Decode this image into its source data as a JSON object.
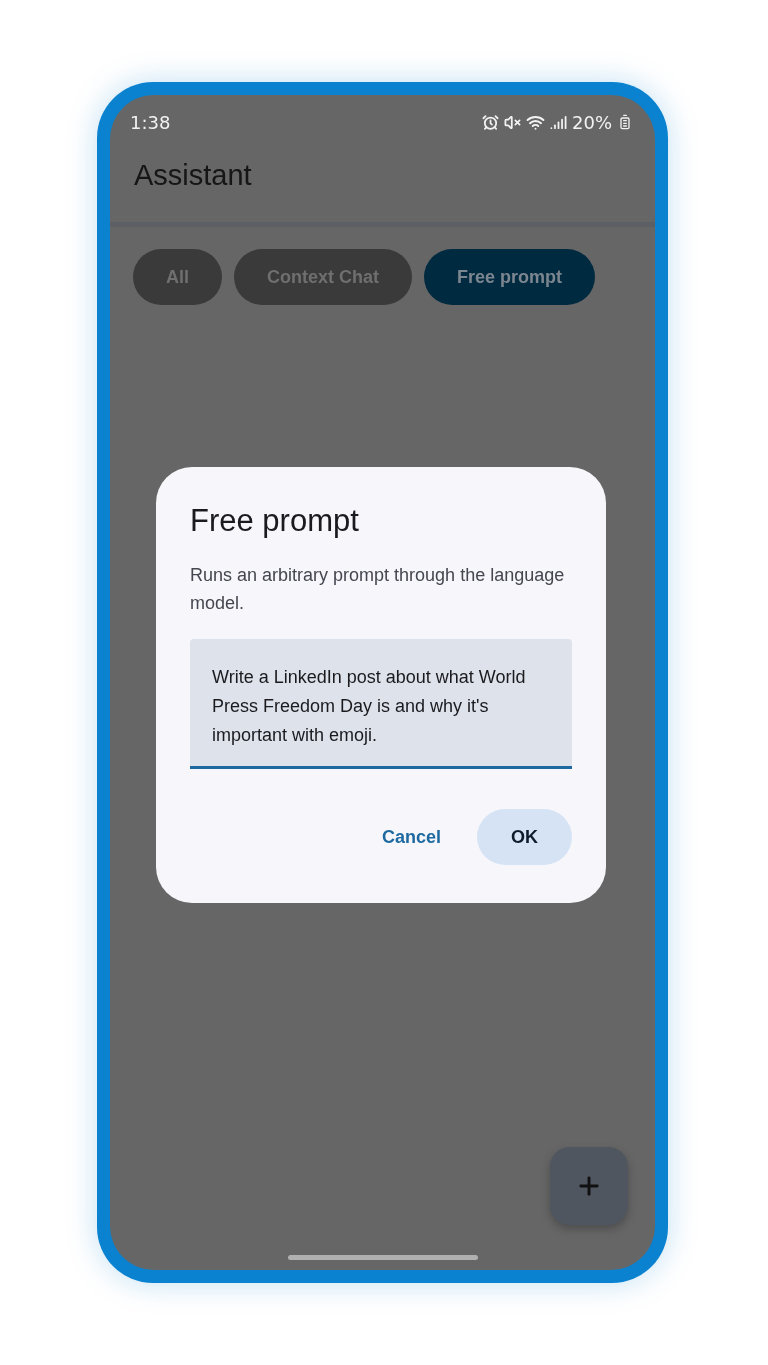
{
  "status_bar": {
    "time": "1:38",
    "battery": "20%"
  },
  "app_bar": {
    "title": "Assistant"
  },
  "chips": [
    {
      "label": "All",
      "selected": false
    },
    {
      "label": "Context Chat",
      "selected": false
    },
    {
      "label": "Free prompt",
      "selected": true
    }
  ],
  "dialog": {
    "title": "Free prompt",
    "description": "Runs an arbitrary prompt through the language model.",
    "field": {
      "value": "Write a LinkedIn post about what World Press Freedom Day is and why it's important with emoji."
    },
    "buttons": [
      {
        "label": "Cancel",
        "kind": "text"
      },
      {
        "label": "OK",
        "kind": "tonal"
      }
    ]
  }
}
